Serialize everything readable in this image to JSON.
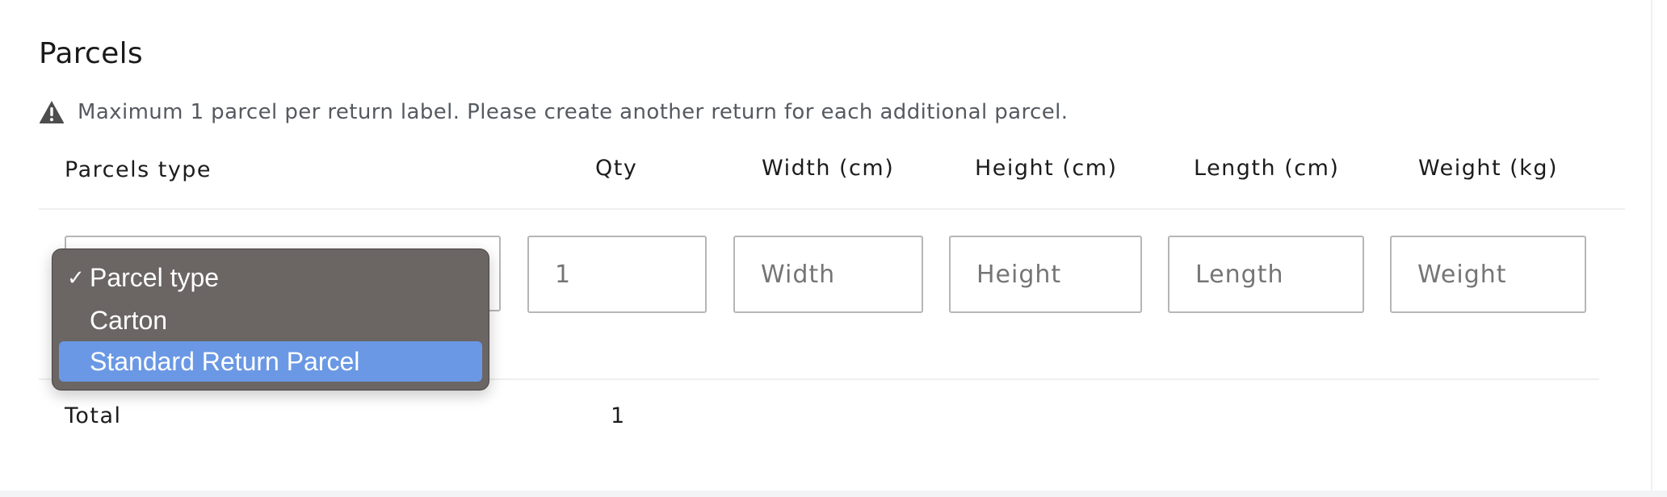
{
  "section": {
    "title": "Parcels",
    "notice_icon": "warning-icon",
    "notice": "Maximum 1 parcel per return label. Please create another return for each additional parcel."
  },
  "table": {
    "headers": {
      "parcels_type": "Parcels type",
      "qty": "Qty",
      "width": "Width (cm)",
      "height": "Height (cm)",
      "length": "Length (cm)",
      "weight": "Weight (kg)"
    },
    "row": {
      "qty_placeholder": "1",
      "width_placeholder": "Width",
      "height_placeholder": "Height",
      "length_placeholder": "Length",
      "weight_placeholder": "Weight"
    },
    "total": {
      "label": "Total",
      "qty": "1"
    }
  },
  "dropdown": {
    "options": [
      {
        "label": "Parcel type",
        "checked": true,
        "highlighted": false
      },
      {
        "label": "Carton",
        "checked": false,
        "highlighted": false
      },
      {
        "label": "Standard Return Parcel",
        "checked": false,
        "highlighted": true
      }
    ],
    "check_mark": "✓",
    "highlight_color": "#6a98e4",
    "menu_color": "#6b6564"
  }
}
